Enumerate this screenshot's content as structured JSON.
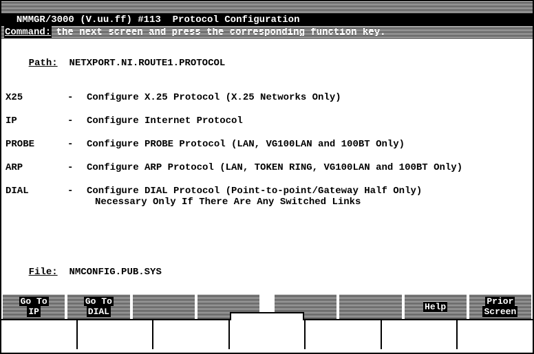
{
  "header": {
    "title": "NMMGR/3000 (V.uu.ff) #113  Protocol Configuration",
    "instruction": "Select the next screen and press the corresponding function key.",
    "command_label": "Command:"
  },
  "path_label": "Path:",
  "path_value": "NETXPORT.NI.ROUTE1.PROTOCOL",
  "options": [
    {
      "key": "X25",
      "desc": "Configure X.25 Protocol (X.25 Networks Only)",
      "desc2": ""
    },
    {
      "key": "IP",
      "desc": "Configure Internet Protocol",
      "desc2": ""
    },
    {
      "key": "PROBE",
      "desc": "Configure PROBE Protocol (LAN, VG100LAN and 100BT Only)",
      "desc2": ""
    },
    {
      "key": "ARP",
      "desc": "Configure ARP Protocol (LAN, TOKEN RING, VG100LAN and 100BT Only)",
      "desc2": ""
    },
    {
      "key": "DIAL",
      "desc": "Configure DIAL Protocol (Point-to-point/Gateway Half Only)",
      "desc2": "Necessary Only If There Are Any Switched Links"
    }
  ],
  "file_label": "File:",
  "file_value": "NMCONFIG.PUB.SYS",
  "fkeys": [
    {
      "line1": "Go To",
      "line2": "IP",
      "active": true
    },
    {
      "line1": "Go To",
      "line2": "DIAL",
      "active": true
    },
    {
      "line1": "",
      "line2": "",
      "active": false
    },
    {
      "line1": "",
      "line2": "",
      "active": false
    },
    {
      "line1": "",
      "line2": "",
      "active": false
    },
    {
      "line1": "",
      "line2": "",
      "active": false
    },
    {
      "line1": "Help",
      "line2": "",
      "active": true
    },
    {
      "line1": "Prior",
      "line2": "Screen",
      "active": true
    }
  ]
}
